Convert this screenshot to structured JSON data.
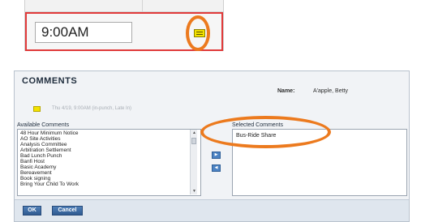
{
  "timecard": {
    "time_value": "9:00AM"
  },
  "comments_dialog": {
    "title": "COMMENTS",
    "name_label": "Name:",
    "name_value": "A'apple, Betty",
    "punch_info": "Thu 4/19, 9:00AM (in-punch, Late In)",
    "available_label": "Available Comments",
    "selected_label": "Selected Comments",
    "available_items": [
      "48 Hour Minimum Notice",
      "AO Site Activities",
      "Analysis Committee",
      "Arbitration Settlement",
      "Bad Lunch Punch",
      "Banfi Host",
      "Basic Academy",
      "Bereavement",
      "Book signing",
      "Bring Your Child To Work"
    ],
    "selected_items": [
      "Bus-Ride Share"
    ],
    "add_arrow": "▶",
    "remove_arrow": "◀",
    "scroll_up": "▲",
    "scroll_down": "▼",
    "ok_label": "OK",
    "cancel_label": "Cancel"
  },
  "colors": {
    "highlight_ring": "#ec7a1e",
    "time_cell_border": "#e03a3a",
    "comment_icon": "#f3e200",
    "button_blue": "#2f5a90"
  },
  "icons": {
    "timecard_comment": "comment-note-icon",
    "punch": "punch-note-icon"
  }
}
